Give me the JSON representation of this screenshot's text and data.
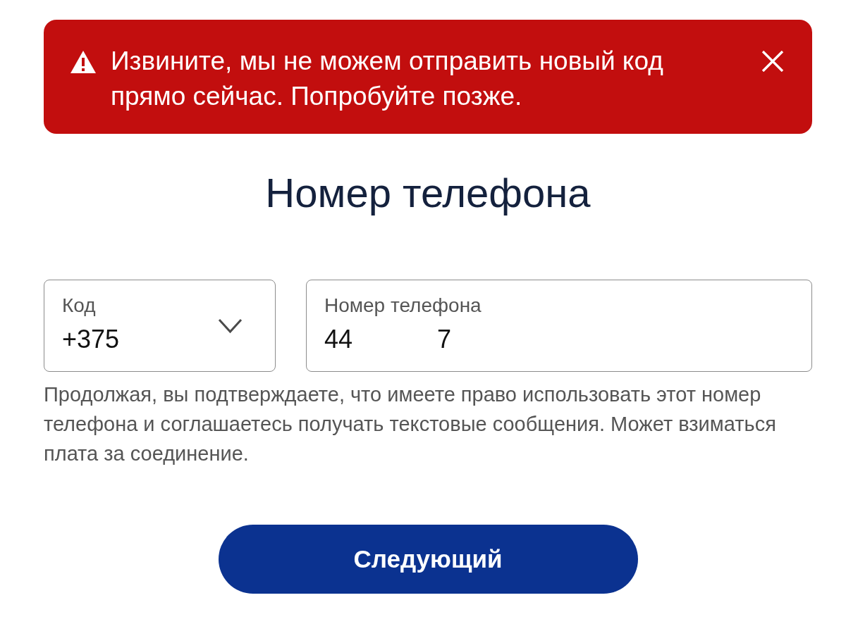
{
  "alert": {
    "kind": "error",
    "message": "Извините, мы не можем отправить новый код прямо сейчас. Попробуйте позже."
  },
  "title": "Номер телефона",
  "fields": [
    {
      "kind": "dropdown",
      "label": "Код",
      "value": "+375"
    },
    {
      "kind": "text",
      "label": "Номер телефона",
      "value": "44            7"
    }
  ],
  "disclaimer": "Продолжая, вы подтверждаете, что имеете право использовать этот номер телефона и соглашаетесь получать текстовые сообщения. Может взиматься плата за соединение.",
  "buttons": [
    "Следующий"
  ]
}
